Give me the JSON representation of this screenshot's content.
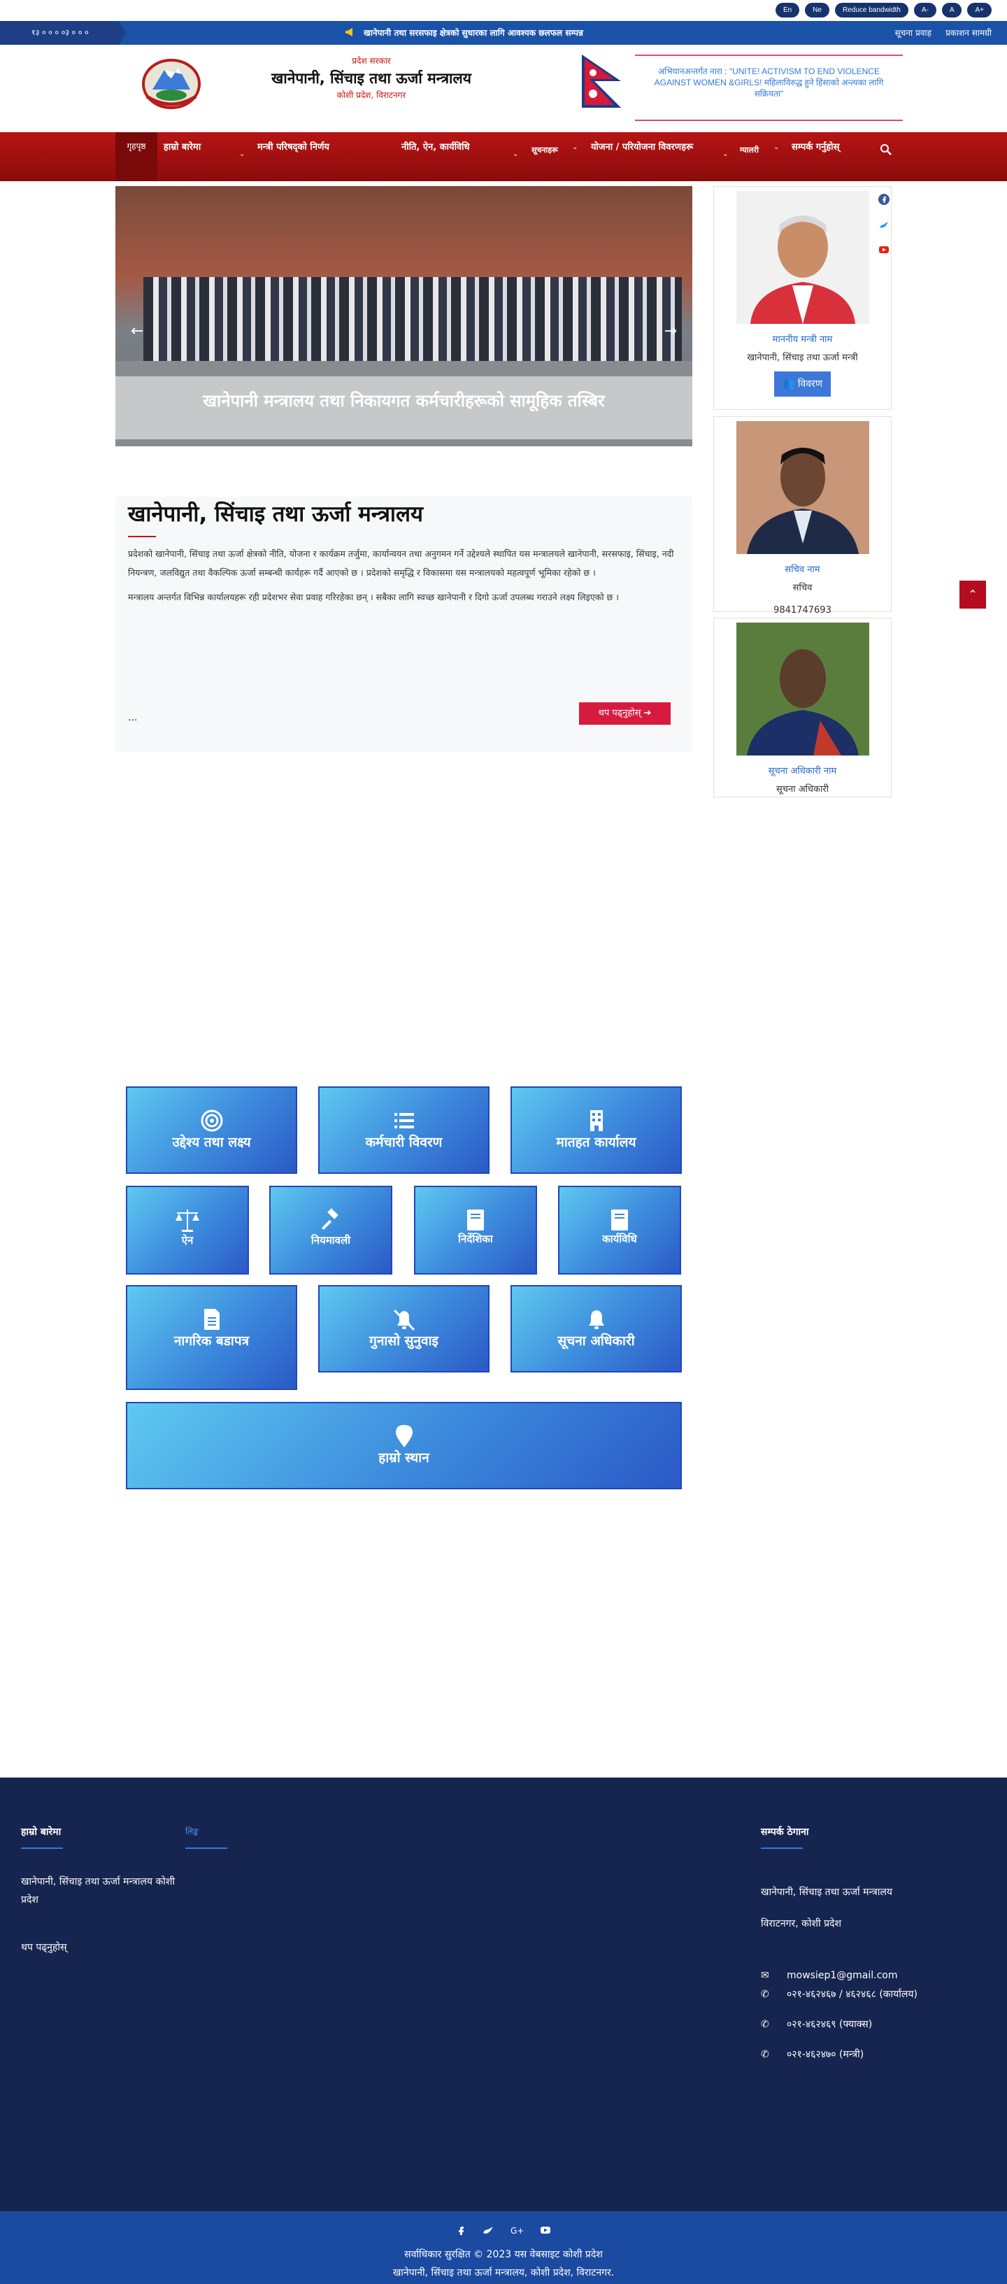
{
  "top_bar": {
    "buttons": [
      "En",
      "Ne",
      "Reduce bandwidth",
      "A-",
      "A",
      "A+"
    ]
  },
  "ticker": {
    "date": "१३ ० ० ०  ०३ ० ० ०",
    "news": "खानेपानी तथा सरसफाइ क्षेत्रको सुधारका लागि आवश्यक छलफल सम्पन्न",
    "links": [
      "सूचना प्रवाह",
      "प्रकाशन सामग्री"
    ]
  },
  "header": {
    "gov_label": "प्रदेश सरकार",
    "ministry_name": "खानेपानी, सिंचाइ तथा ऊर्जा मन्त्रालय",
    "address": "कोशी प्रदेश, विराटनगर",
    "slogan": "अभियानअन्तर्गत नारा : \"UNITE! ACTIVISM TO END VIOLENCE AGAINST WOMEN &GIRLS! महिलाविरुद्ध हुने हिंसाको अन्त्यका लागि सक्रियता\""
  },
  "nav": {
    "home": "गृहपृष्ठ",
    "items": [
      "हाम्रो बारेमा",
      "मन्त्री परिषद्को निर्णय",
      "नीति, ऐन, कार्यविधि",
      "सूचनाहरू",
      "योजना / परियोजना विवरणहरू",
      "ग्यालरी",
      "सम्पर्क गर्नुहोस्"
    ]
  },
  "slider": {
    "caption": "खानेपानी मन्त्रालय तथा निकायगत कर्मचारीहरूको सामूहिक तस्बिर"
  },
  "intro": {
    "heading": "खानेपानी, सिंचाइ तथा ऊर्जा मन्त्रालय",
    "paragraph1": "प्रदेशको खानेपानी, सिंचाइ तथा ऊर्जा क्षेत्रको नीति, योजना र कार्यक्रम तर्जुमा, कार्यान्वयन तथा अनुगमन गर्ने उद्देश्यले स्थापित यस मन्त्रालयले खानेपानी, सरसफाइ, सिंचाइ, नदी नियन्त्रण, जलविद्युत तथा वैकल्पिक ऊर्जा सम्बन्धी कार्यहरू गर्दै आएको छ । प्रदेशको समृद्धि र विकासमा यस मन्त्रालयको महत्वपूर्ण भूमिका रहेको छ ।",
    "paragraph2": "मन्त्रालय अन्तर्गत विभिन्न कार्यालयहरू रही प्रदेशभर सेवा प्रवाह गरिरहेका छन् । सबैका लागि स्वच्छ खानेपानी र दिगो ऊर्जा उपलब्ध गराउने लक्ष्य लिइएको छ ।",
    "ellipsis": "...",
    "read_more": "थप पढ्नुहोस्"
  },
  "officials": [
    {
      "name": "माननीय मन्त्री नाम",
      "role": "खानेपानी, सिंचाइ तथा ऊर्जा मन्त्री",
      "extra_label": "विवरण"
    },
    {
      "name": "सचिव नाम",
      "role": "सचिव",
      "phone": "9841747693"
    },
    {
      "name": "सूचना अधिकारी नाम",
      "role": "सूचना अधिकारी"
    }
  ],
  "tiles": {
    "row1": [
      "उद्देश्य तथा लक्ष्य",
      "कर्मचारी विवरण",
      "मातहत कार्यालय"
    ],
    "row2": [
      "ऐन",
      "नियमावली",
      "निर्देशिका",
      "कार्यविधि"
    ],
    "row3": [
      "नागरिक बडापत्र",
      "गुनासो सुनुवाइ",
      "सूचना अधिकारी"
    ],
    "row4": [
      "हाम्रो स्थान"
    ]
  },
  "footer": {
    "col1_title": "हाम्रो बारेमा",
    "col1_text": "खानेपानी, सिंचाइ तथा ऊर्जा मन्त्रालय कोशी प्रदेश",
    "col1_link": "थप पढ्नुहोस्",
    "col2_title": "लिङ्क",
    "col3_title": "सम्पर्क ठेगाना",
    "org_name": "खानेपानी, सिंचाइ तथा ऊर्जा मन्त्रालय",
    "address": "विराटनगर, कोशी प्रदेश",
    "email": "mowsiep1@gmail.com",
    "phone1": "०२१-४६२४६७ / ४६२४६८ (कार्यालय)",
    "phone2": "०२१-४६२४६९ (फ्याक्स)",
    "phone3": "०२१-४६२४७० (मन्त्री)"
  },
  "copyright": {
    "line1": "सर्वाधिकार सुरक्षित © 2023 यस वेबसाइट कोशी प्रदेश",
    "line2": "खानेपानी, सिंचाइ तथा ऊर्जा मन्त्रालय, कोशी प्रदेश, विराटनगर."
  },
  "colors": {
    "nav_red": "#a81010",
    "ticker_blue": "#1a52a8",
    "footer_navy": "#16254f",
    "tile_blue": "#3c89dc"
  }
}
